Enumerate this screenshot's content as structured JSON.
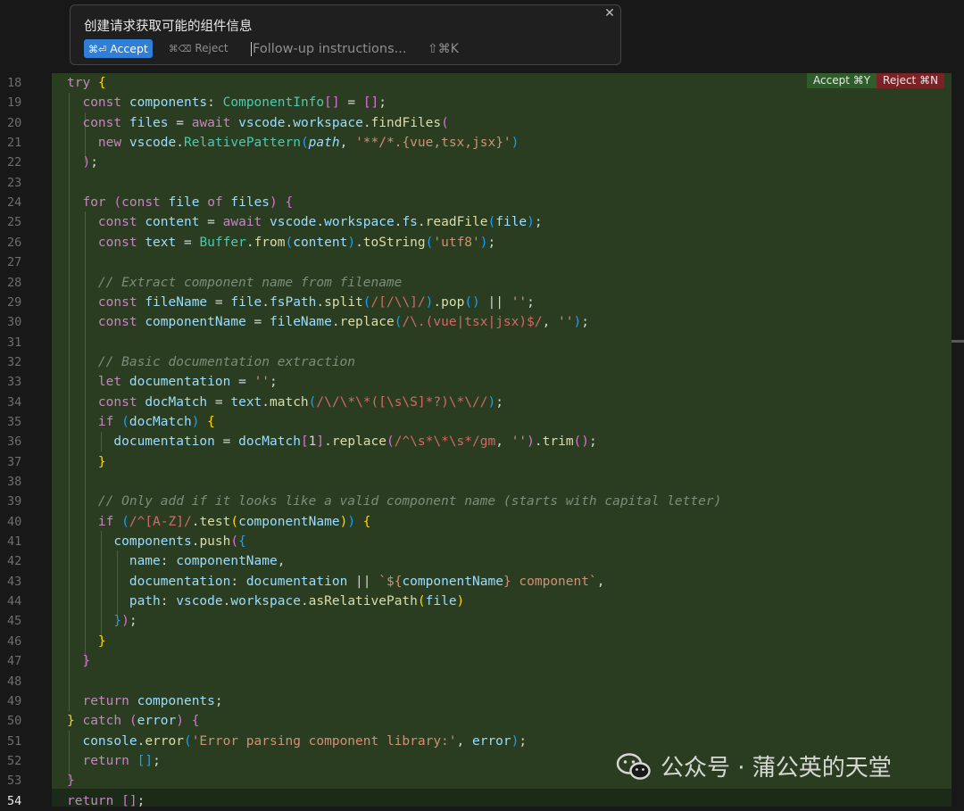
{
  "prompt": {
    "title": "创建请求获取可能的组件信息",
    "accept_key": "⌘⏎",
    "accept_label": "Accept",
    "reject_key": "⌘⌫",
    "reject_label": "Reject",
    "followup_placeholder": "Follow-up instructions...",
    "followup_shortcut": "⇧⌘K",
    "close_icon": "close-icon"
  },
  "diff_actions": {
    "accept_label": "Accept ⌘Y",
    "reject_label": "Reject ⌘N"
  },
  "editor": {
    "current_line": 54,
    "line_numbers": [
      "18",
      "19",
      "20",
      "21",
      "22",
      "23",
      "24",
      "25",
      "26",
      "27",
      "28",
      "29",
      "30",
      "31",
      "32",
      "33",
      "34",
      "35",
      "36",
      "37",
      "38",
      "39",
      "40",
      "41",
      "42",
      "43",
      "44",
      "45",
      "46",
      "47",
      "48",
      "49",
      "50",
      "51",
      "52",
      "53",
      "54"
    ]
  },
  "watermark": {
    "text": "公众号 · 蒲公英的天堂",
    "icon": "wechat-icon"
  }
}
